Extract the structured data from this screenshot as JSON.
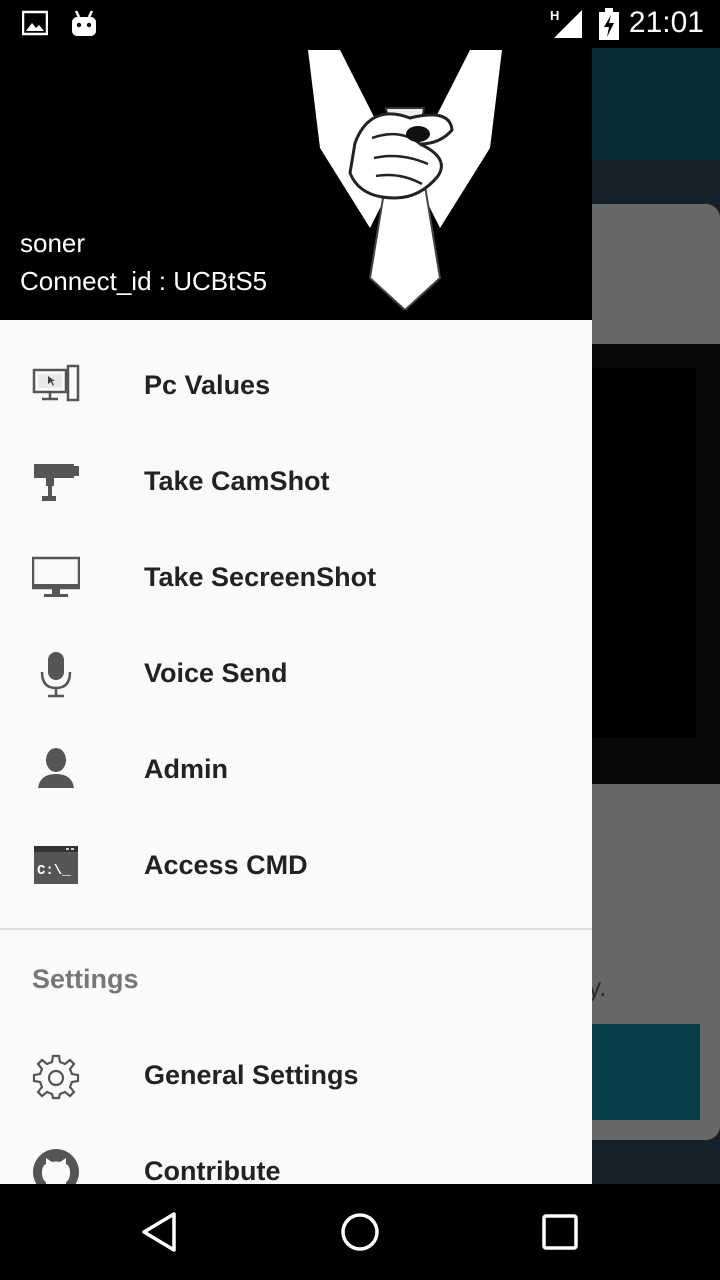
{
  "status_bar": {
    "time": "21:01",
    "network_label": "H",
    "icons": [
      "image-notification-icon",
      "android-notification-icon",
      "signal-icon",
      "battery-charging-icon"
    ]
  },
  "drawer": {
    "header": {
      "user_name": "soner",
      "connect_id": "Connect_id : UCBtS5"
    },
    "items": [
      {
        "label": "Pc Values",
        "icon": "pc-values-icon"
      },
      {
        "label": "Take CamShot",
        "icon": "security-camera-icon"
      },
      {
        "label": "Take SecreenShot",
        "icon": "monitor-icon"
      },
      {
        "label": "Voice Send",
        "icon": "microphone-icon"
      },
      {
        "label": "Admin",
        "icon": "user-icon"
      },
      {
        "label": "Access CMD",
        "icon": "terminal-icon"
      }
    ],
    "settings_section": {
      "title": "Settings",
      "items": [
        {
          "label": "General Settings",
          "icon": "gear-icon"
        },
        {
          "label": "Contribute",
          "icon": "github-icon"
        }
      ]
    }
  },
  "background": {
    "partial_text": "y."
  },
  "colors": {
    "accent": "#0d5c69",
    "drawer_bg": "#fafafa",
    "header_bg": "#000000"
  }
}
